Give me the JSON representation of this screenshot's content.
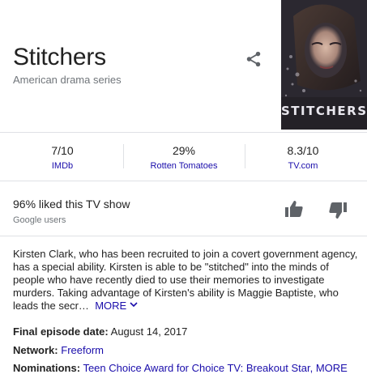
{
  "show": {
    "title": "Stitchers",
    "subtitle": "American drama series",
    "poster_word": "STITCHERS"
  },
  "share": {
    "icon": "share-icon"
  },
  "ratings": [
    {
      "score": "7/10",
      "source": "IMDb"
    },
    {
      "score": "29%",
      "source": "Rotten Tomatoes"
    },
    {
      "score": "8.3/10",
      "source": "TV.com"
    }
  ],
  "audience": {
    "liked_text": "96% liked this TV show",
    "sub_text": "Google users",
    "thumbs_up_icon": "thumbs-up-icon",
    "thumbs_down_icon": "thumbs-down-icon"
  },
  "description": {
    "text": "Kirsten Clark, who has been recruited to join a covert government agency, has a special ability. Kirsten is able to be \"stitched\" into the minds of people who have recently died to use their memories to investigate murders. Taking advantage of Kirsten's ability is Maggie Baptiste, who leads the secr…",
    "more_label": "MORE",
    "more_icon": "chevron-down-icon"
  },
  "facts": {
    "final_episode": {
      "label": "Final episode date:",
      "value": "August 14, 2017"
    },
    "network": {
      "label": "Network:",
      "value": "Freeform"
    },
    "nominations": {
      "label": "Nominations:",
      "value": "Teen Choice Award for Choice TV: Breakout Star",
      "more_label": "MORE"
    }
  },
  "colors": {
    "link": "#1a0dab",
    "secondary_text": "#70757a",
    "divider": "#dfe1e5",
    "icon_gray": "#5f6368"
  }
}
